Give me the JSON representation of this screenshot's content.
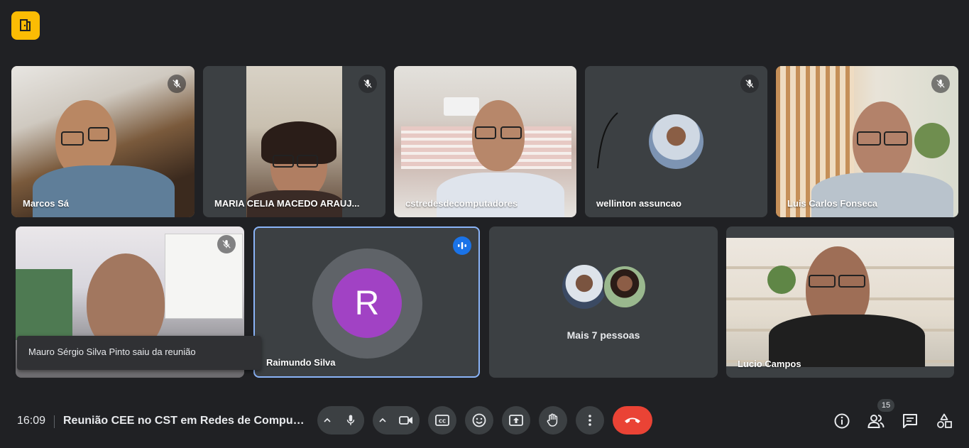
{
  "app": {
    "logo_icon": "meet-door-icon",
    "accent": "#fbbc04"
  },
  "participants": [
    {
      "name": "Marcos Sá",
      "muted": true
    },
    {
      "name": "MARIA CELIA MACEDO ARAUJ...",
      "muted": true
    },
    {
      "name": "cstredesdecomputadores",
      "muted": false
    },
    {
      "name": "wellinton assuncao",
      "muted": true
    },
    {
      "name": "Luis Carlos Fonseca",
      "muted": true
    },
    {
      "name": "Mauro Sérgio Silva Pinto",
      "muted": true
    },
    {
      "name": "Raimundo Silva",
      "initial": "R",
      "speaking": true,
      "avatar_color": "#a142c4"
    },
    {
      "name": "Mais 7 pessoas"
    },
    {
      "name": "Lucio Campos",
      "muted": false
    }
  ],
  "toast": {
    "text": "Mauro Sérgio Silva Pinto saiu da reunião"
  },
  "bottom_bar": {
    "time": "16:09",
    "meeting_title": "Reunião CEE no CST em Redes de Computa...",
    "participant_count": "15",
    "controls": [
      "chevron-up-icon",
      "microphone-icon",
      "chevron-up-icon",
      "camera-icon",
      "captions-icon",
      "emoji-icon",
      "present-icon",
      "raise-hand-icon",
      "more-options-icon",
      "end-call-icon"
    ],
    "right_icons": [
      "info-icon",
      "people-icon",
      "chat-icon",
      "activities-icon"
    ],
    "end_call_color": "#ea4335"
  }
}
